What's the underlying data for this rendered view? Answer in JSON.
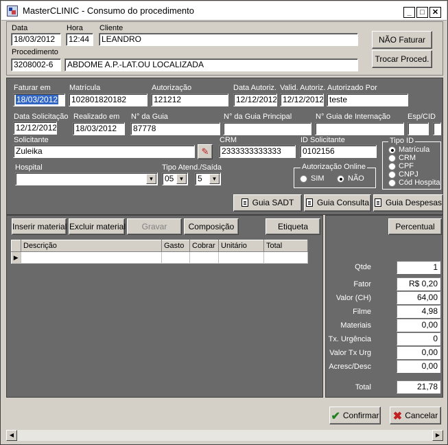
{
  "window": {
    "title": "MasterCLINIC - Consumo do procedimento"
  },
  "header": {
    "data_label": "Data",
    "data_value": "18/03/2012",
    "hora_label": "Hora",
    "hora_value": "12:44",
    "cliente_label": "Cliente",
    "cliente_value": "LEANDRO",
    "procedimento_label": "Procedimento",
    "procedimento_code": "3208002-6",
    "procedimento_desc": "ABDOME A.P.-LAT.OU LOCALIZADA",
    "nao_faturar_button": "NÃO Faturar",
    "trocar_proced_button": "Trocar Proced."
  },
  "form": {
    "faturar_em_label": "Faturar em",
    "faturar_em_value": "18/03/2012",
    "matricula_label": "Matrícula",
    "matricula_value": "102801820182",
    "autorizacao_label": "Autorização",
    "autorizacao_value": "121212",
    "data_autoriz_label": "Data Autoriz.",
    "data_autoriz_value": "12/12/2012",
    "valid_autoriz_label": "Valid. Autoriz.",
    "valid_autoriz_value": "12/12/2012",
    "autorizado_por_label": "Autorizado Por",
    "autorizado_por_value": "teste",
    "data_solicitacao_label": "Data Solicitação",
    "data_solicitacao_value": "12/12/2012",
    "realizado_em_label": "Realizado em",
    "realizado_em_value": "18/03/2012",
    "n_guia_label": "N° da Guia",
    "n_guia_value": "87778",
    "n_guia_principal_label": "N° da Guia Principal",
    "n_guia_principal_value": "",
    "n_guia_internacao_label": "N° Guia de Internação",
    "n_guia_internacao_value": "",
    "esp_cid_label": "Esp/CID",
    "esp_value": "",
    "cid_value": "",
    "solicitante_label": "Solicitante",
    "solicitante_value": "Zuleika",
    "crm_label": "CRM",
    "crm_value": "2333333333333",
    "id_solicitante_label": "ID Solicitante",
    "id_solicitante_value": "0102156",
    "hospital_label": "Hospital",
    "hospital_value": "",
    "tipo_atend_label": "Tipo Atend./Saída",
    "tipo_atend_value": "05",
    "saida_value": "5",
    "autorizacao_online_label": "Autorização Online",
    "sim_label": "SIM",
    "nao_label": "NÃO",
    "tipo_id_label": "Tipo ID",
    "tipo_id_options": [
      "Matrícula",
      "CRM",
      "CPF",
      "CNPJ",
      "Cód Hospita"
    ],
    "guia_sadt_button": "Guia SADT",
    "guia_consulta_button": "Guia Consulta",
    "guia_despesas_button": "Guia Despesas"
  },
  "materials": {
    "inserir_button": "Inserir material",
    "excluir_button": "Excluir material",
    "gravar_button": "Gravar",
    "composicao_button": "Composição",
    "etiqueta_button": "Etiqueta",
    "columns": [
      "Descrição",
      "Gasto",
      "Cobrar",
      "Unitário",
      "Total"
    ]
  },
  "summary": {
    "percentual_button": "Percentual",
    "qtde_label": "Qtde",
    "qtde_value": "1",
    "fator_label": "Fator",
    "fator_value": "R$ 0,20",
    "valor_ch_label": "Valor (CH)",
    "valor_ch_value": "64,00",
    "filme_label": "Filme",
    "filme_value": "4,98",
    "materiais_label": "Materiais",
    "materiais_value": "0,00",
    "tx_urgencia_label": "Tx. Urgência",
    "tx_urgencia_value": "0",
    "valor_tx_urg_label": "Valor Tx Urg",
    "valor_tx_urg_value": "0,00",
    "acresc_desc_label": "Acresc/Desc",
    "acresc_desc_value": "0,00",
    "total_label": "Total",
    "total_value": "21,78"
  },
  "footer": {
    "confirmar_button": "Confirmar",
    "cancelar_button": "Cancelar"
  }
}
